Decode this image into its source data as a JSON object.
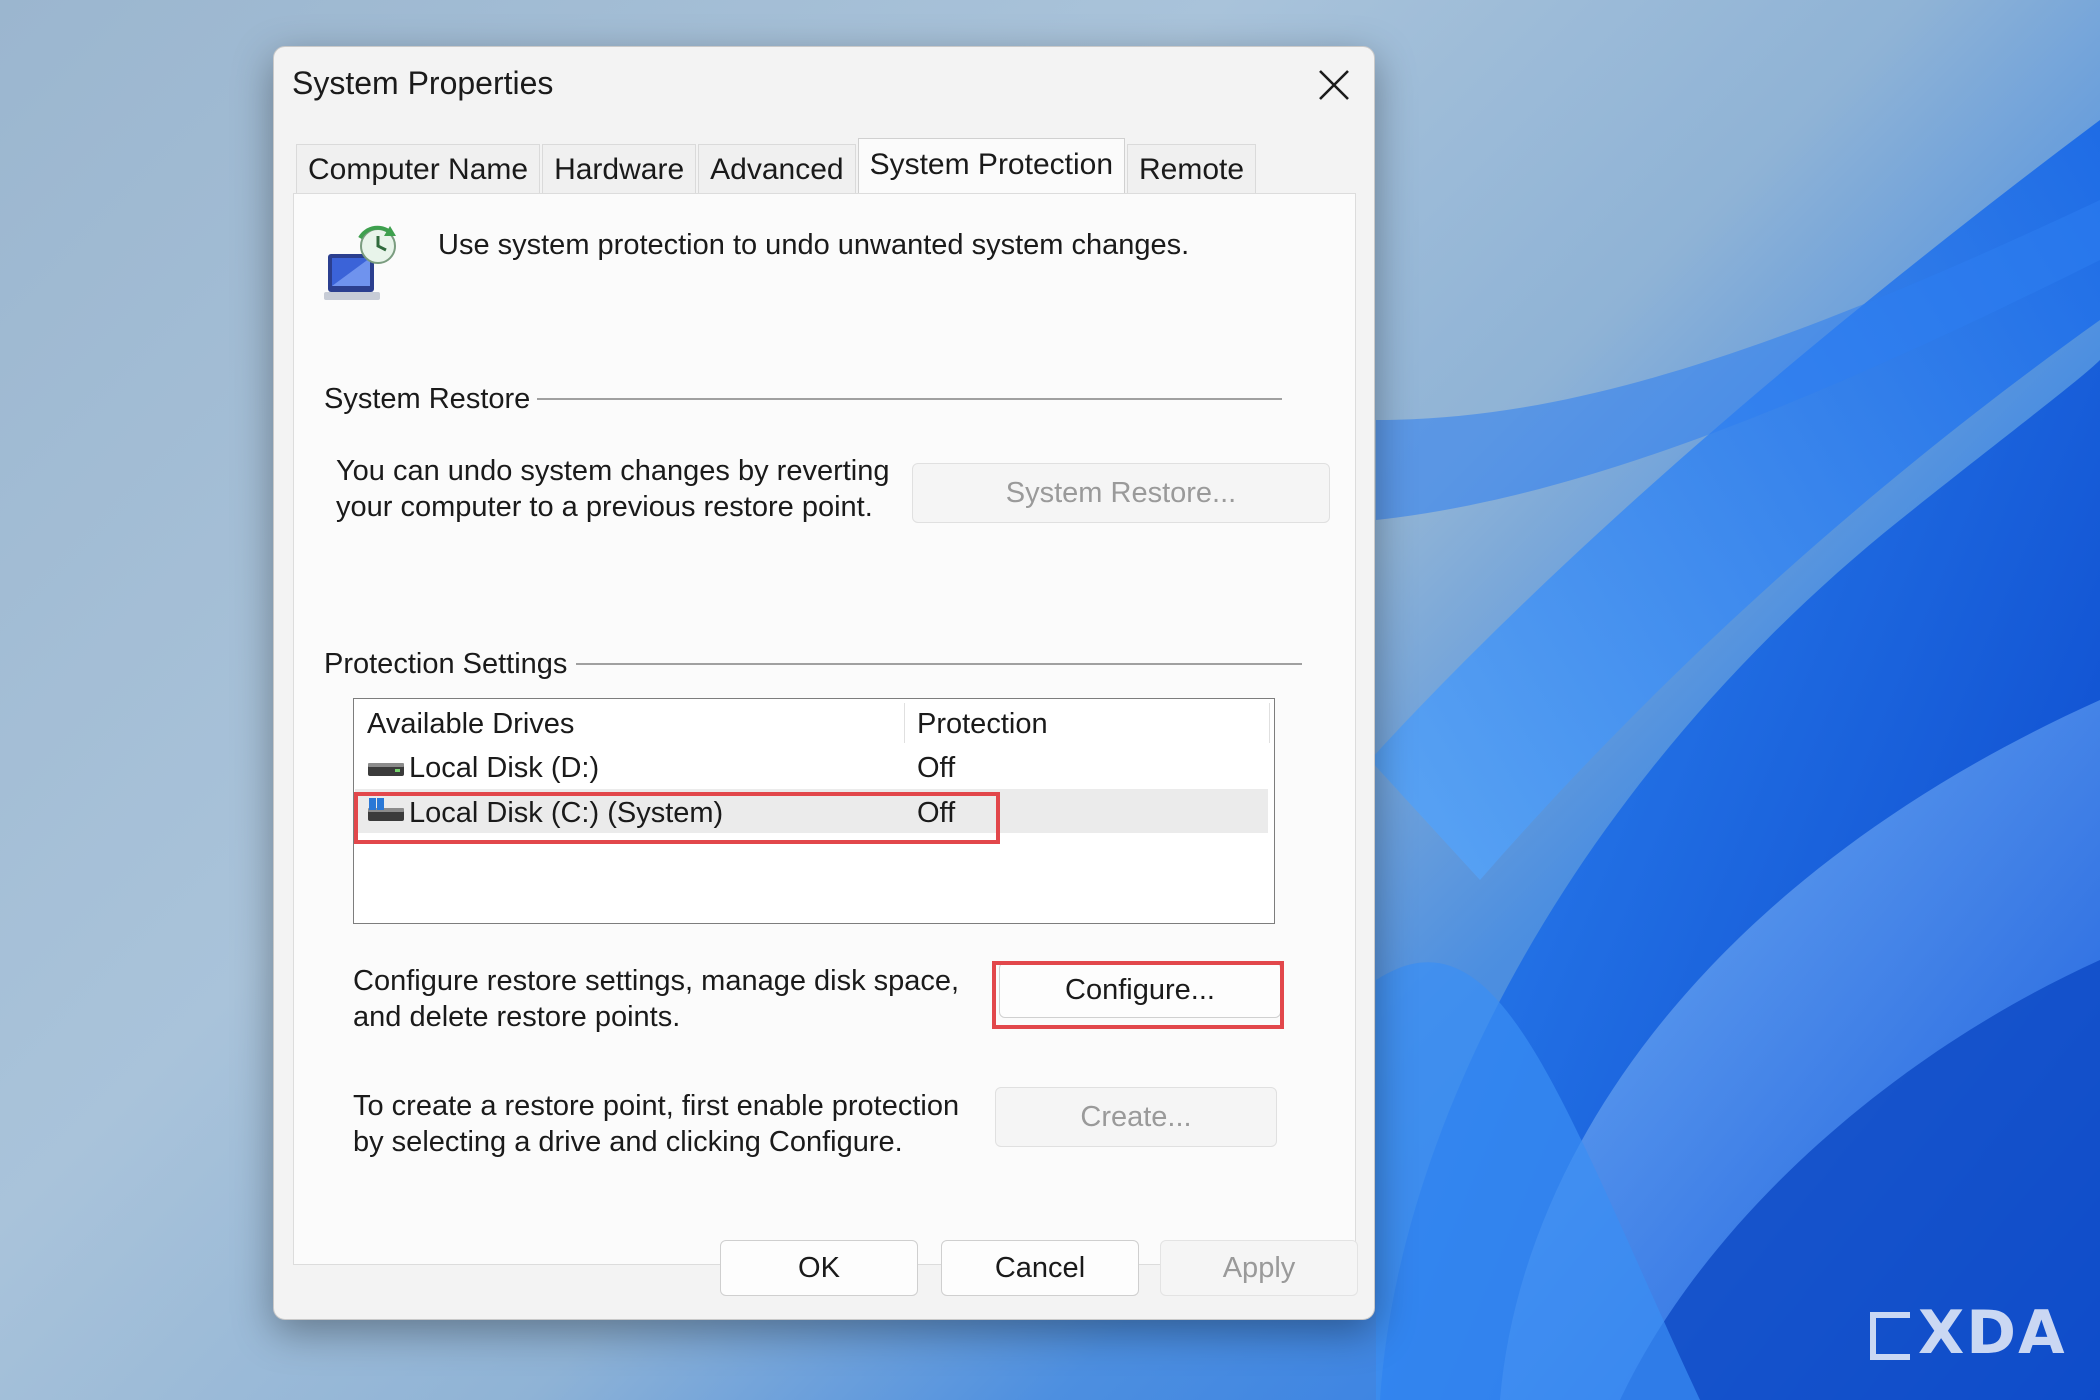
{
  "window": {
    "title": "System Properties"
  },
  "tabs": [
    {
      "label": "Computer Name",
      "active": false
    },
    {
      "label": "Hardware",
      "active": false
    },
    {
      "label": "Advanced",
      "active": false
    },
    {
      "label": "System Protection",
      "active": true
    },
    {
      "label": "Remote",
      "active": false
    }
  ],
  "intro": {
    "icon": "system-protection-icon",
    "text": "Use system protection to undo unwanted system changes."
  },
  "system_restore": {
    "group_label": "System Restore",
    "description_line1": "You can undo system changes by reverting",
    "description_line2": "your computer to a previous restore point.",
    "button_label": "System Restore...",
    "button_enabled": false
  },
  "protection_settings": {
    "group_label": "Protection Settings",
    "columns": [
      "Available Drives",
      "Protection"
    ],
    "drives": [
      {
        "name": "Local Disk (D:)",
        "protection": "Off",
        "icon": "hard-drive-icon",
        "selected": false
      },
      {
        "name": "Local Disk (C:) (System)",
        "protection": "Off",
        "icon": "windows-drive-icon",
        "selected": true
      }
    ],
    "configure_desc_line1": "Configure restore settings, manage disk space,",
    "configure_desc_line2": "and delete restore points.",
    "configure_button": "Configure...",
    "create_desc_line1": "To create a restore point, first enable protection",
    "create_desc_line2": "by selecting a drive and clicking Configure.",
    "create_button": "Create...",
    "create_enabled": false
  },
  "footer": {
    "ok": "OK",
    "cancel": "Cancel",
    "apply": "Apply",
    "apply_enabled": false
  },
  "watermark": "XDA",
  "colors": {
    "highlight": "#e2474b",
    "desktop_accent": "#1f6fe6"
  }
}
